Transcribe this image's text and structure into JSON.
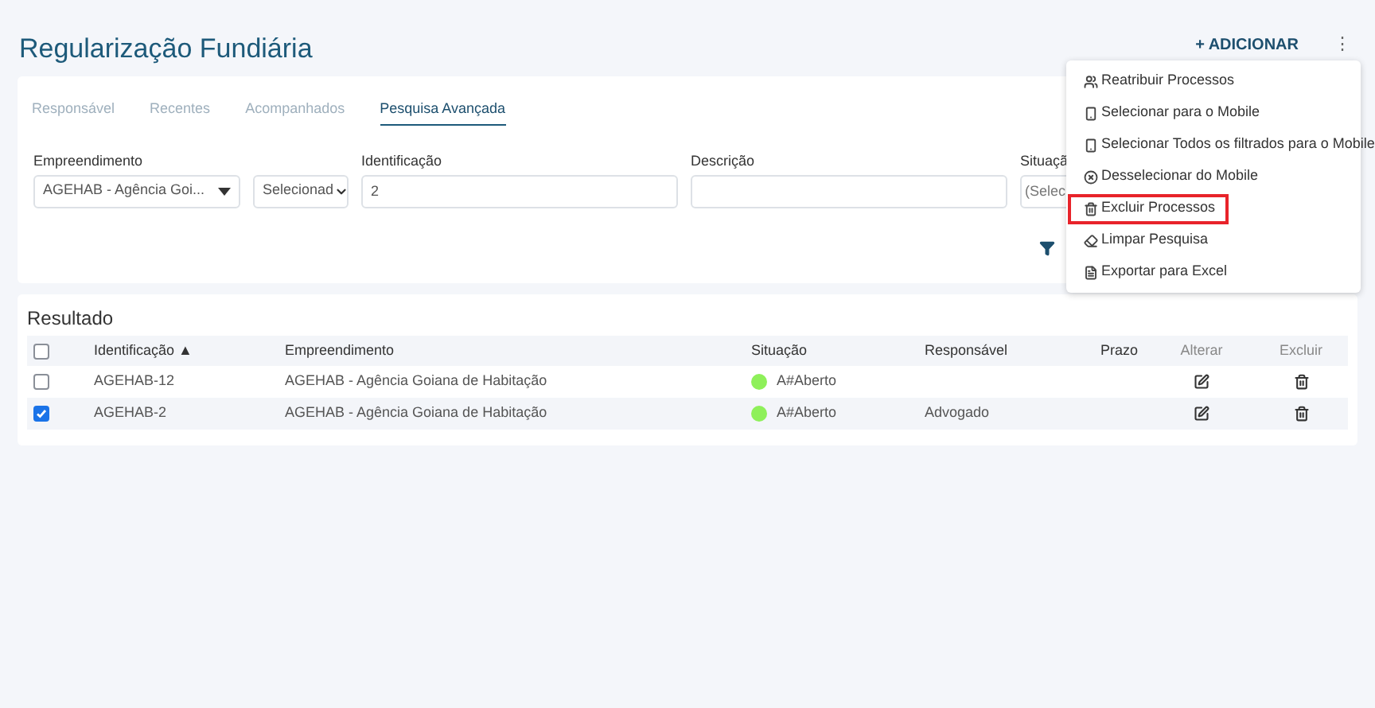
{
  "title": "Regularização Fundiária",
  "add_button": "+ ADICIONAR",
  "more_button": "⋮",
  "tabs": [
    {
      "label": "Responsável",
      "selected": false
    },
    {
      "label": "Recentes",
      "selected": false
    },
    {
      "label": "Acompanhados",
      "selected": false
    },
    {
      "label": "Pesquisa Avançada",
      "selected": true
    }
  ],
  "filters": [
    {
      "kind": "select",
      "label": "Empreendimento",
      "value": "AGEHAB - Agência Goi..."
    },
    {
      "kind": "native-select",
      "value": "Selecionad"
    },
    {
      "kind": "text",
      "label": "Identificação",
      "value": "2"
    },
    {
      "kind": "text",
      "label": "Descrição"
    },
    {
      "kind": "text",
      "label": "Situaçã",
      "placeholder": "(Selec"
    }
  ],
  "result": {
    "title": "Resultado",
    "columns": [
      {
        "kind": "checkbox",
        "checked": false
      },
      {
        "label": "Identificação ▲"
      },
      {
        "label": "Empreendimento"
      },
      {
        "label": "Situação"
      },
      {
        "label": "Responsável"
      },
      {
        "label": "Prazo"
      },
      {
        "label": "Alterar",
        "muted": true
      },
      {
        "label": "Excluir",
        "muted": true
      }
    ],
    "rows": [
      {
        "checked": false,
        "id": "AGEHAB-12",
        "empreendimento": "AGEHAB - Agência Goiana de Habitação",
        "color": "#8ef05a",
        "situacao": "A#Aberto"
      },
      {
        "checked": true,
        "id": "AGEHAB-2",
        "empreendimento": "AGEHAB - Agência Goiana de Habitação",
        "color": "#8ef05a",
        "situacao": "A#Aberto",
        "responsavel": "Advogado"
      }
    ]
  },
  "menu": [
    {
      "kind": "reassign",
      "label": "Reatribuir Processos",
      "highlighted": false
    },
    {
      "kind": "mobile",
      "label": "Selecionar para o Mobile",
      "highlighted": false
    },
    {
      "kind": "mobile",
      "label": "Selecionar Todos os filtrados para o Mobile",
      "highlighted": false
    },
    {
      "kind": "deselect",
      "label": "Desselecionar do Mobile",
      "highlighted": false
    },
    {
      "kind": "delete",
      "label": "Excluir Processos",
      "highlighted": true
    },
    {
      "kind": "erase",
      "label": "Limpar Pesquisa",
      "highlighted": false
    },
    {
      "kind": "export",
      "label": "Exportar para Excel",
      "highlighted": false
    }
  ]
}
